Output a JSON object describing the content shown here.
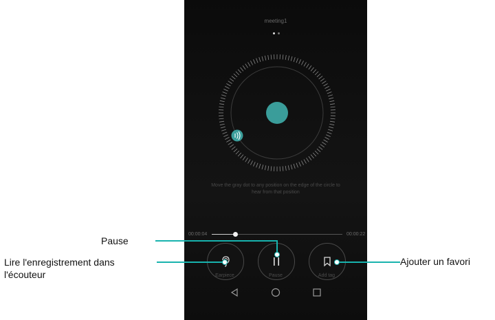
{
  "recording": {
    "title": "meeting1",
    "hint_line1": "Move the gray dot to any position on the edge of the circle to",
    "hint_line2": "hear from that position",
    "elapsed": "00:00:04",
    "total": "00:00:22",
    "progress_fraction": 0.18
  },
  "controls": {
    "earpiece_label": "Earpiece",
    "pause_label": "Pause",
    "add_tag_label": "Add tag"
  },
  "callouts": {
    "pause": "Pause",
    "earpiece_line1": "Lire l'enregistrement dans",
    "earpiece_line2": "l'écouteur",
    "favorite": "Ajouter un favori"
  },
  "colors": {
    "accent": "#3a9d9a",
    "callout_line": "#18b3ae"
  },
  "icons": {
    "earpiece": "ear-icon",
    "pause": "pause-icon",
    "tag": "bookmark-icon",
    "speaker": "speaker-wave-icon",
    "back": "back-triangle-icon",
    "home": "home-circle-icon",
    "recent": "recent-square-icon"
  }
}
